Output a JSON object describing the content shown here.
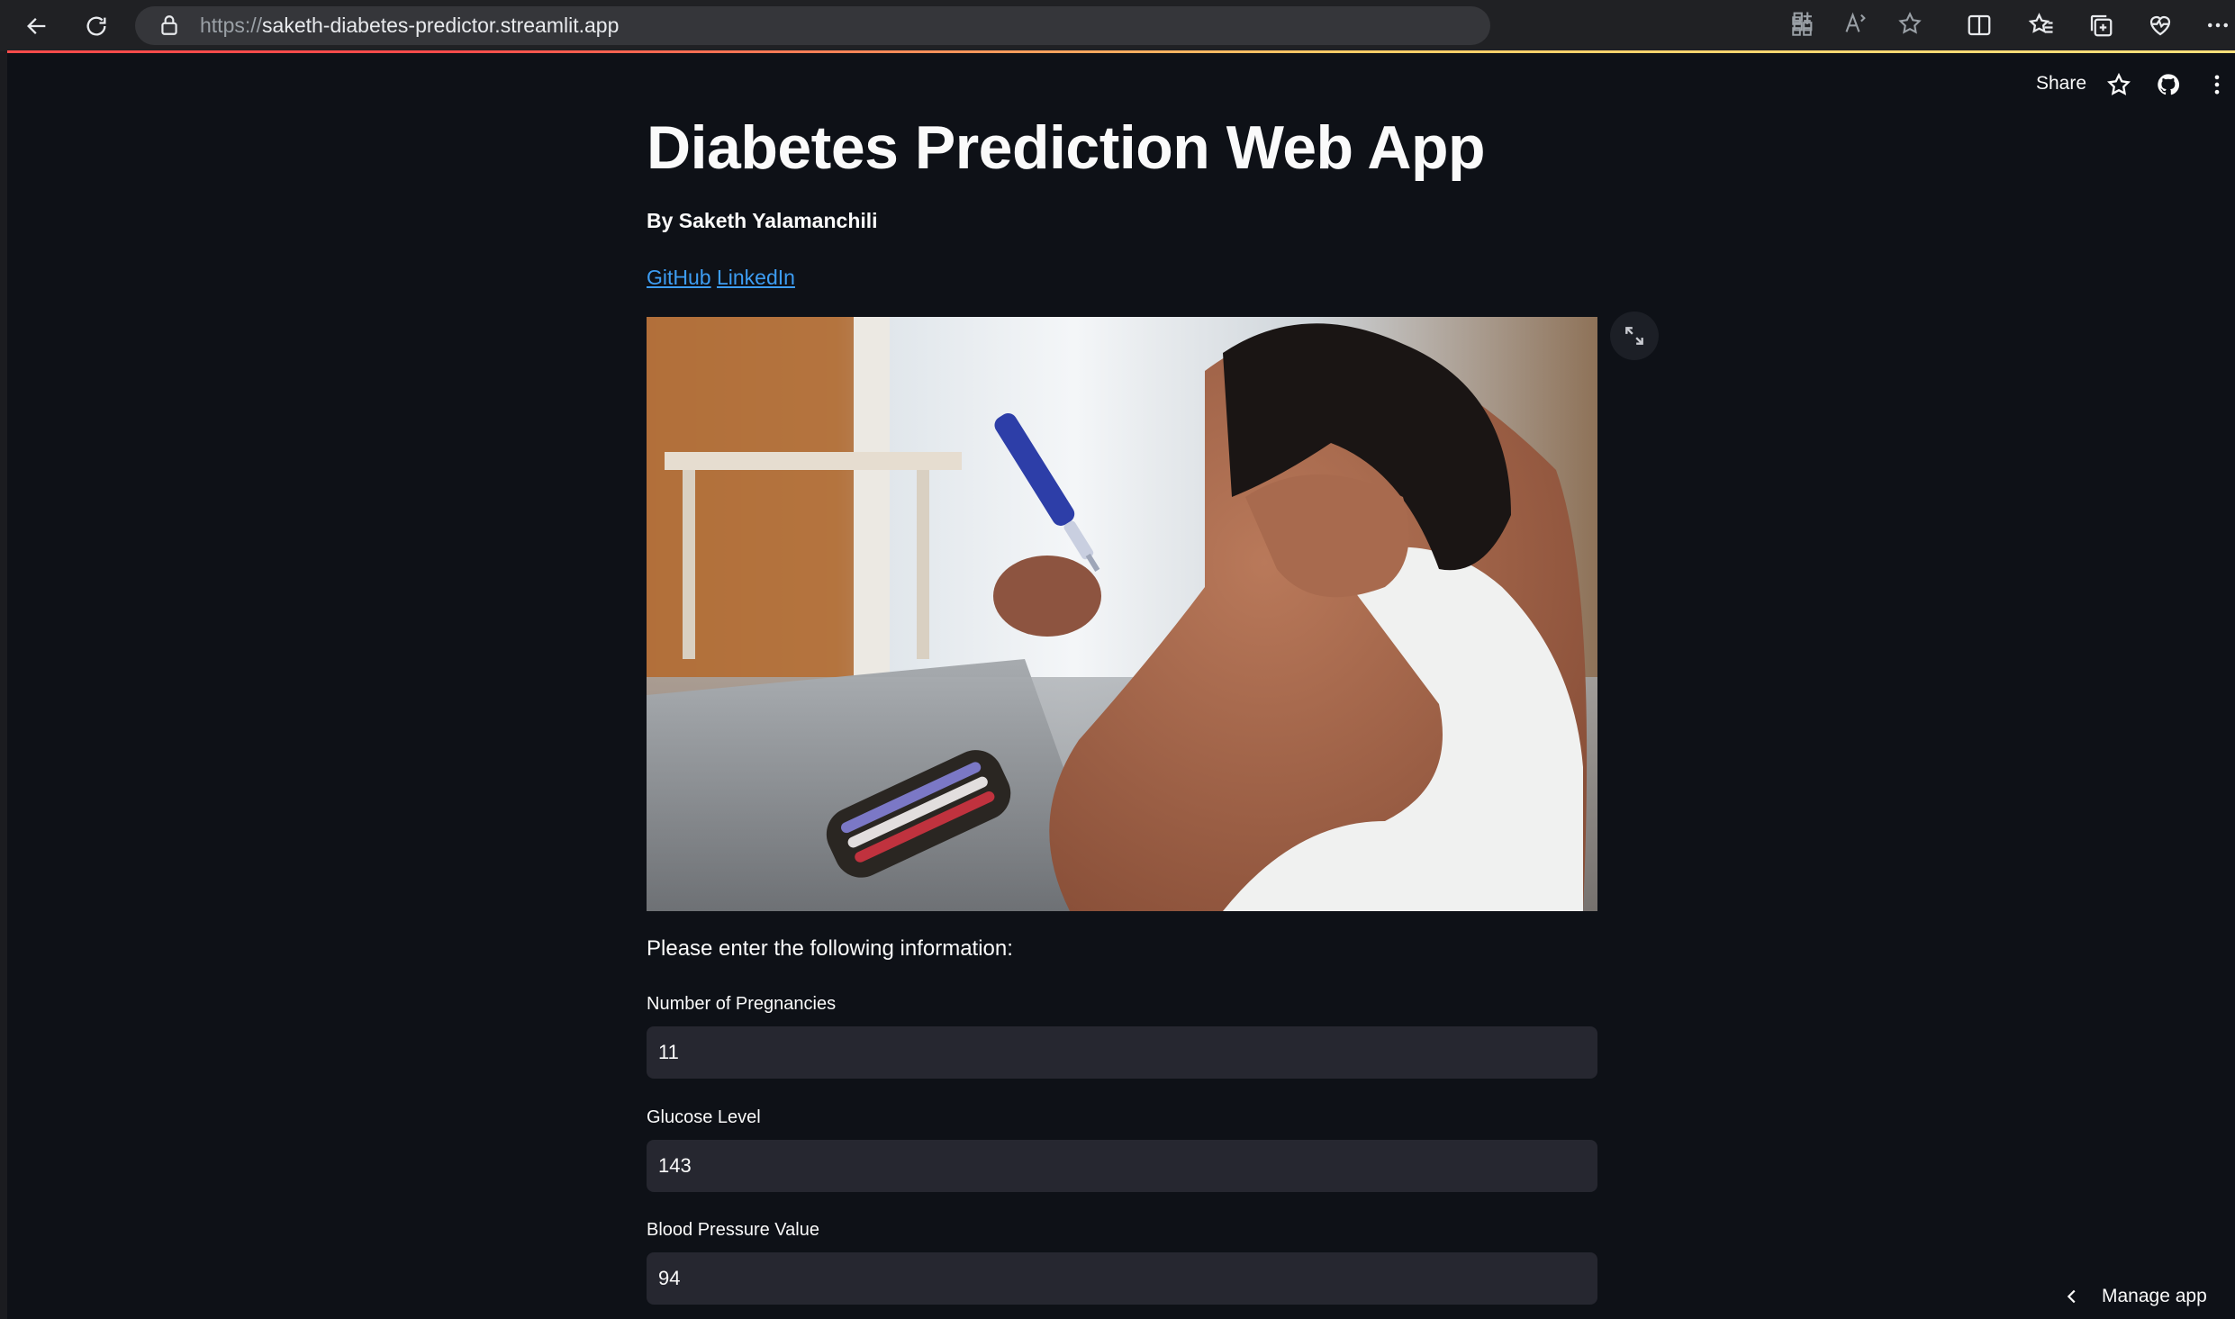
{
  "browser": {
    "url_scheme": "https://",
    "url_host": "saketh-diabetes-predictor.streamlit.app",
    "icons": [
      "back-icon",
      "reload-icon",
      "lock-icon",
      "app-install-icon",
      "read-aloud-icon",
      "favorite-star-icon",
      "split-screen-icon",
      "favorites-icon",
      "collections-icon",
      "health-icon",
      "more-icon"
    ]
  },
  "streamlit_header": {
    "share_label": "Share"
  },
  "app": {
    "title": "Diabetes Prediction Web App",
    "author": "By Saketh Yalamanchili",
    "links": {
      "github": "GitHub",
      "linkedin": "LinkedIn"
    },
    "prompt": "Please enter the following information:",
    "fields": [
      {
        "label": "Number of Pregnancies",
        "value": "11"
      },
      {
        "label": "Glucose Level",
        "value": "143"
      },
      {
        "label": "Blood Pressure Value",
        "value": "94"
      }
    ]
  },
  "footer": {
    "manage_app_label": "Manage app"
  },
  "colors": {
    "background": "#0e1117",
    "input_bg": "#262730",
    "link": "#3d9df3",
    "accent": "#ff4b4b"
  }
}
